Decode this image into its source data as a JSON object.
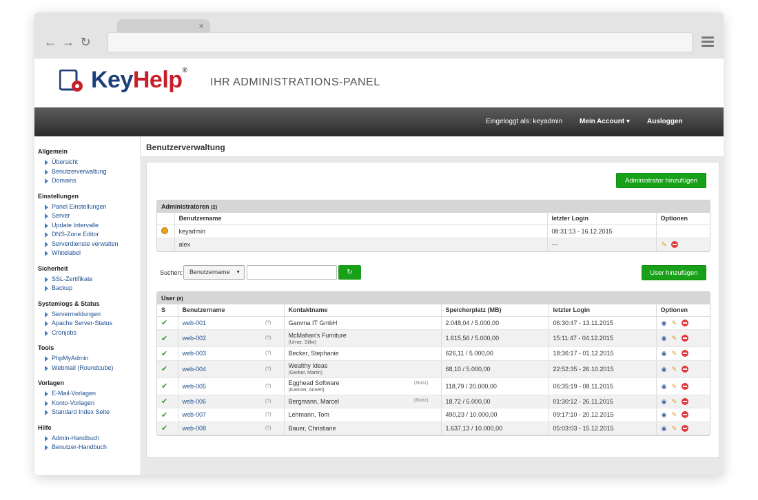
{
  "browser": {
    "tab_close": "×",
    "nav": {
      "back": "←",
      "forward": "→",
      "reload": "↻"
    }
  },
  "brand": {
    "logo_key": "Key",
    "logo_help": "Help",
    "logo_reg": "®",
    "subtitle": "IHR ADMINISTRATIONS-PANEL"
  },
  "topbar": {
    "logged_in": "Eingeloggt als: keyadmin",
    "account": "Mein Account ▾",
    "logout": "Ausloggen"
  },
  "sidebar": {
    "groups": [
      {
        "title": "Allgemein",
        "items": [
          "Übersicht",
          "Benutzerverwaltung",
          "Domains"
        ]
      },
      {
        "title": "Einstellungen",
        "items": [
          "Panel Einstellungen",
          "Server",
          "Update Intervalle",
          "DNS-Zone Editor",
          "Serverdienste verwalten",
          "Whitelabel"
        ]
      },
      {
        "title": "Sicherheit",
        "items": [
          "SSL-Zertifikate",
          "Backup"
        ]
      },
      {
        "title": "Systemlogs & Status",
        "items": [
          "Servermeldungen",
          "Apache Server-Status",
          "Cronjobs"
        ]
      },
      {
        "title": "Tools",
        "items": [
          "PhpMyAdmin",
          "Webmail (Roundcube)"
        ]
      },
      {
        "title": "Vorlagen",
        "items": [
          "E-Mail-Vorlagen",
          "Konto-Vorlagen",
          "Standard Index Seite"
        ]
      },
      {
        "title": "Hilfe",
        "items": [
          "Admin-Handbuch",
          "Benutzer-Handbuch"
        ]
      }
    ]
  },
  "content": {
    "title": "Benutzerverwaltung",
    "add_admin": "Administrator hinzufügen",
    "add_user": "User hinzufügen",
    "admins": {
      "title": "Administratoren",
      "count": "(2)",
      "headers": [
        "Benutzername",
        "letzter Login",
        "Optionen"
      ],
      "rows": [
        {
          "name": "keyadmin",
          "login": "08:31:13 - 16.12.2015"
        },
        {
          "name": "alex",
          "login": "---"
        }
      ]
    },
    "search": {
      "label": "Suchen:",
      "select": "Benutzername",
      "button": "↻"
    },
    "users": {
      "title": "User",
      "count": "(8)",
      "headers": [
        "S",
        "Benutzername",
        "Kontaktname",
        "Speicherplatz (MB)",
        "letzter Login",
        "Optionen"
      ],
      "q": "(?)",
      "notiz": "(Notiz)",
      "rows": [
        {
          "user": "web-001",
          "contact": "Gamma IT GmbH",
          "sub": "",
          "notiz": false,
          "space": "2.048,04 / 5.000,00",
          "login": "06:30:47 - 13.11.2015"
        },
        {
          "user": "web-002",
          "contact": "McMahan's Furniture",
          "sub": "(Urner, Silke)",
          "notiz": false,
          "space": "1.615,56 / 5.000,00",
          "login": "15:11:47 - 04.12.2015"
        },
        {
          "user": "web-003",
          "contact": "Becker, Stephanie",
          "sub": "",
          "notiz": false,
          "space": "626,11 / 5.000,00",
          "login": "18:36:17 - 01.12.2015"
        },
        {
          "user": "web-004",
          "contact": "Wealthy Ideas",
          "sub": "(Gerber, Martin)",
          "notiz": false,
          "space": "68,10 / 5.000,00",
          "login": "22:52:35 - 26.10.2015"
        },
        {
          "user": "web-005",
          "contact": "Egghead Software",
          "sub": "(Kastner, Annett)",
          "notiz": true,
          "space": "118,79 / 20.000,00",
          "login": "06:35:19 - 08.11.2015"
        },
        {
          "user": "web-006",
          "contact": "Bergmann, Marcel",
          "sub": "",
          "notiz": true,
          "space": "18,72 / 5.000,00",
          "login": "01:30:12 - 26.11.2015"
        },
        {
          "user": "web-007",
          "contact": "Lehmann, Tom",
          "sub": "",
          "notiz": false,
          "space": "490,23 / 10.000,00",
          "login": "09:17:10 - 20.12.2015"
        },
        {
          "user": "web-008",
          "contact": "Bauer, Christiane",
          "sub": "",
          "notiz": false,
          "space": "1.637,13 / 10.000,00",
          "login": "05:03:03 - 15.12.2015"
        }
      ]
    }
  }
}
